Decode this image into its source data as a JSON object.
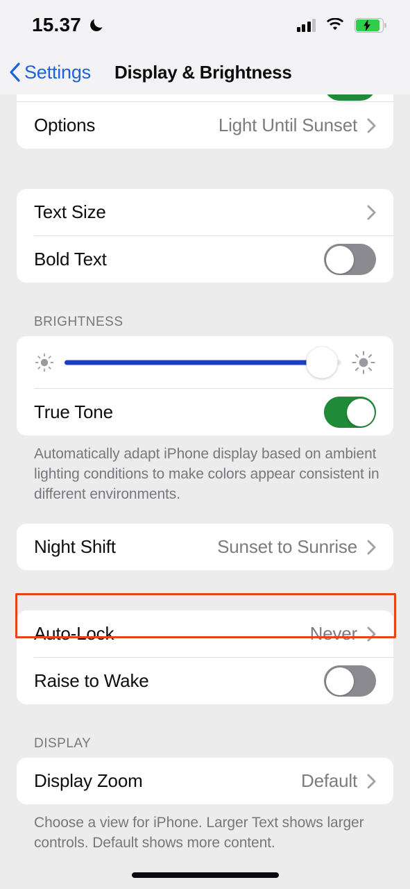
{
  "status_bar": {
    "time": "15.37",
    "dnd_icon": "crescent-moon-icon",
    "signal_icon": "cellular-signal-icon",
    "signal_bars_filled": 3,
    "signal_bars_total": 4,
    "wifi_icon": "wifi-icon",
    "battery_icon": "battery-charging-icon",
    "battery_charging": true,
    "battery_color": "#2fcc50"
  },
  "nav": {
    "back_icon": "chevron-left-icon",
    "back_label": "Settings",
    "title": "Display & Brightness",
    "accent_color": "#1c62d8"
  },
  "appearance_section": {
    "partial_toggle_state": "on",
    "rows": [
      {
        "label": "Options",
        "value": "Light Until Sunset",
        "accessory": "chevron-right-icon"
      }
    ]
  },
  "text_section": {
    "rows": [
      {
        "label": "Text Size",
        "value": "",
        "accessory": "chevron-right-icon"
      },
      {
        "label": "Bold Text",
        "toggle": "off"
      }
    ]
  },
  "brightness_section": {
    "header": "BRIGHTNESS",
    "slider": {
      "name": "brightness-slider",
      "value_percent": 93,
      "min_icon": "sun-small-icon",
      "max_icon": "sun-large-icon",
      "fill_color": "#1a3fc4"
    },
    "rows": [
      {
        "label": "True Tone",
        "toggle": "on"
      }
    ],
    "footer": "Automatically adapt iPhone display based on ambient lighting conditions to make colors appear consistent in different environments."
  },
  "night_shift_section": {
    "rows": [
      {
        "label": "Night Shift",
        "value": "Sunset to Sunrise",
        "accessory": "chevron-right-icon"
      }
    ]
  },
  "lock_section": {
    "rows": [
      {
        "label": "Auto-Lock",
        "value": "Never",
        "accessory": "chevron-right-icon",
        "highlighted": true
      },
      {
        "label": "Raise to Wake",
        "toggle": "off"
      }
    ],
    "highlight_color": "#e8411e"
  },
  "display_section": {
    "header": "DISPLAY",
    "rows": [
      {
        "label": "Display Zoom",
        "value": "Default",
        "accessory": "chevron-right-icon"
      }
    ],
    "footer": "Choose a view for iPhone. Larger Text shows larger controls. Default shows more content."
  },
  "home_indicator": "home-indicator"
}
